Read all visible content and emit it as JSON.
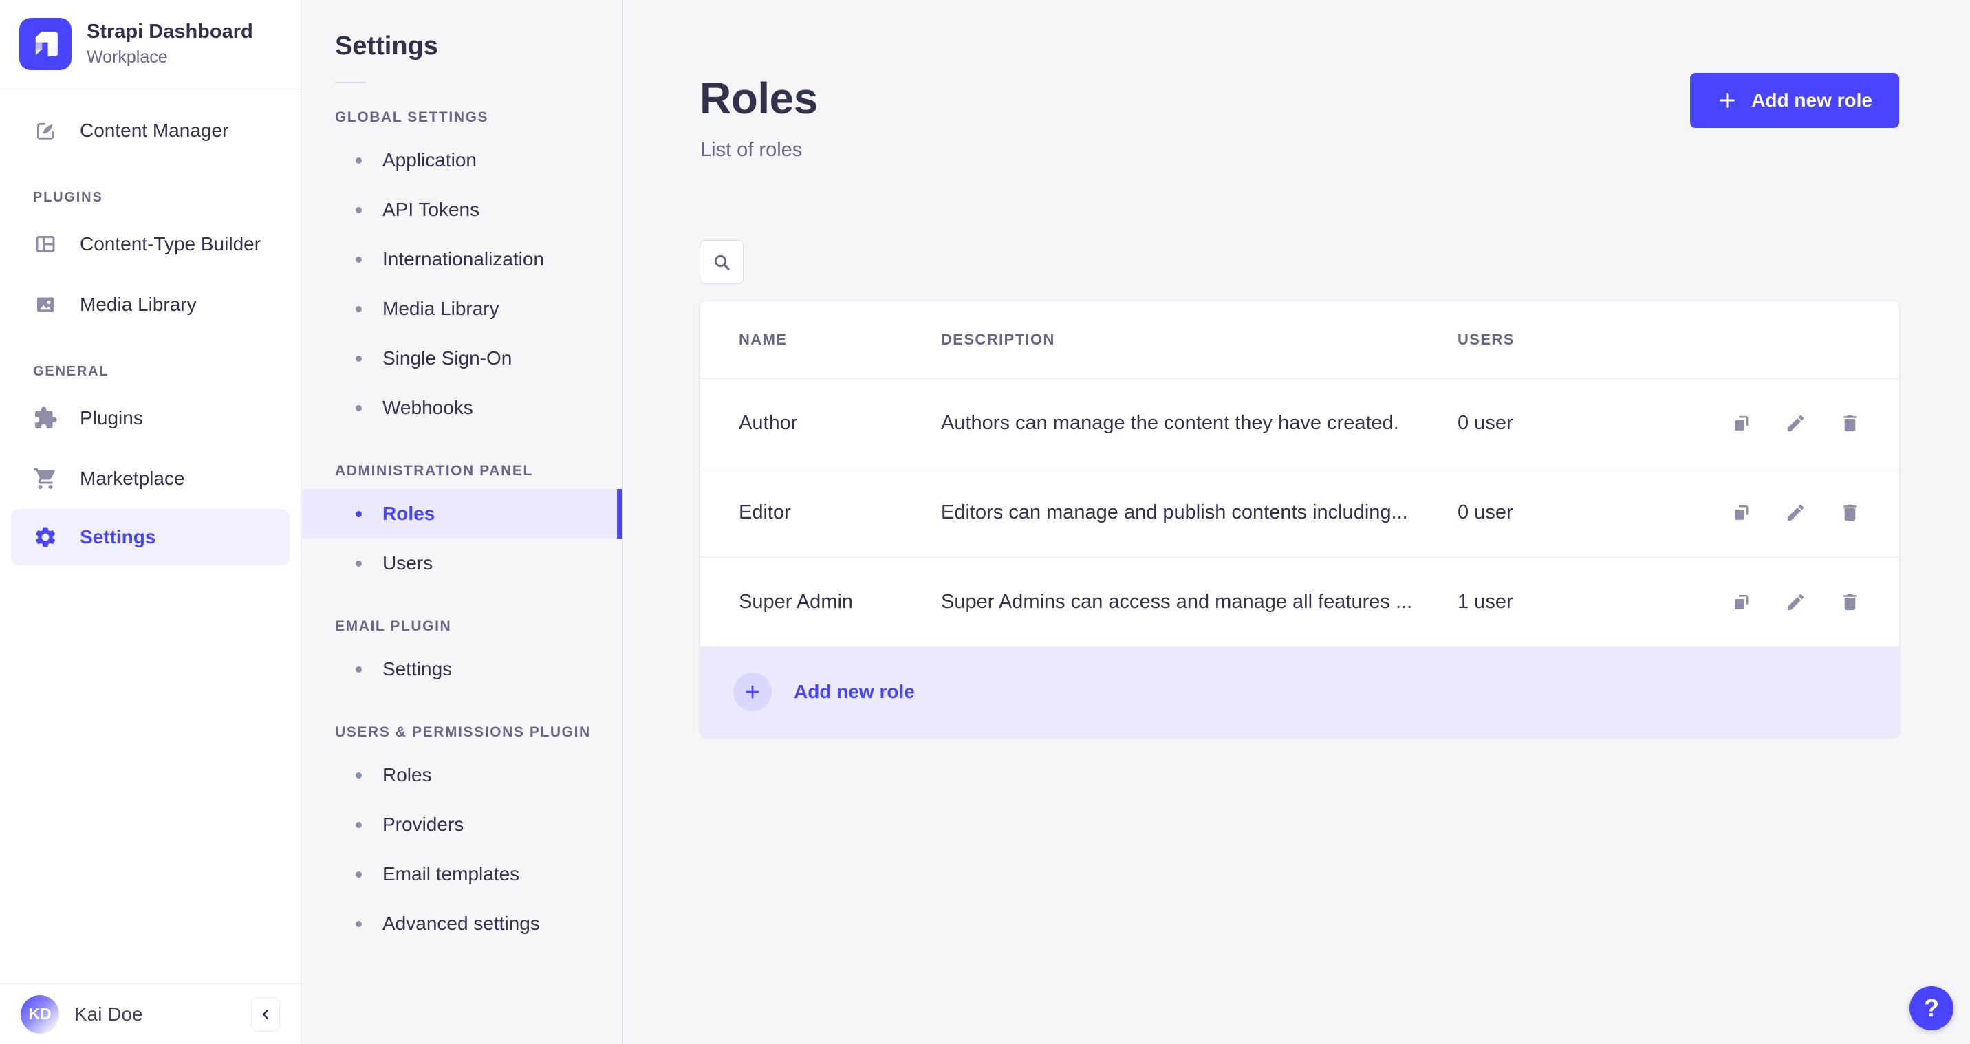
{
  "colors": {
    "accent": "#4945ff",
    "accent_active_bg": "#eaeafc",
    "sidebar_active_bg": "#f0f0ff",
    "plus_circle_bg": "#d9d8ff",
    "text": "#32324d",
    "text_muted": "#666687",
    "icon_muted": "#8e8ea9",
    "border": "#eaeaef",
    "panel_bg": "#f6f6f9"
  },
  "brand": {
    "title": "Strapi Dashboard",
    "subtitle": "Workplace"
  },
  "sidebar": {
    "top_item": {
      "label": "Content Manager",
      "icon": "content-manager-icon"
    },
    "sections": [
      {
        "label": "PLUGINS",
        "items": [
          {
            "label": "Content-Type Builder",
            "icon": "content-type-builder-icon"
          },
          {
            "label": "Media Library",
            "icon": "media-library-icon"
          }
        ]
      },
      {
        "label": "GENERAL",
        "items": [
          {
            "label": "Plugins",
            "icon": "puzzle-icon"
          },
          {
            "label": "Marketplace",
            "icon": "cart-icon"
          },
          {
            "label": "Settings",
            "icon": "gear-icon",
            "active": true
          }
        ]
      }
    ],
    "user": {
      "initials": "KD",
      "name": "Kai Doe"
    },
    "collapse_icon": "chevron-left-icon"
  },
  "subnav": {
    "title": "Settings",
    "sections": [
      {
        "label": "GLOBAL SETTINGS",
        "items": [
          "Application",
          "API Tokens",
          "Internationalization",
          "Media Library",
          "Single Sign-On",
          "Webhooks"
        ]
      },
      {
        "label": "ADMINISTRATION PANEL",
        "items": [
          "Roles",
          "Users"
        ],
        "active_item": "Roles"
      },
      {
        "label": "EMAIL PLUGIN",
        "items": [
          "Settings"
        ]
      },
      {
        "label": "USERS & PERMISSIONS PLUGIN",
        "items": [
          "Roles",
          "Providers",
          "Email templates",
          "Advanced settings"
        ]
      }
    ]
  },
  "main": {
    "title": "Roles",
    "subtitle": "List of roles",
    "add_button_label": "Add new role",
    "search_icon": "magnifier-icon",
    "table": {
      "headers": [
        "NAME",
        "DESCRIPTION",
        "USERS"
      ],
      "rows": [
        {
          "name": "Author",
          "description": "Authors can manage the content they have created.",
          "users": "0 user"
        },
        {
          "name": "Editor",
          "description": "Editors can manage and publish contents including...",
          "users": "0 user"
        },
        {
          "name": "Super Admin",
          "description": "Super Admins can access and manage all features ...",
          "users": "1 user"
        }
      ],
      "row_action_icons": [
        "copy-icon",
        "pencil-icon",
        "trash-icon"
      ]
    },
    "footer_add_label": "Add new role",
    "help_label": "?"
  }
}
